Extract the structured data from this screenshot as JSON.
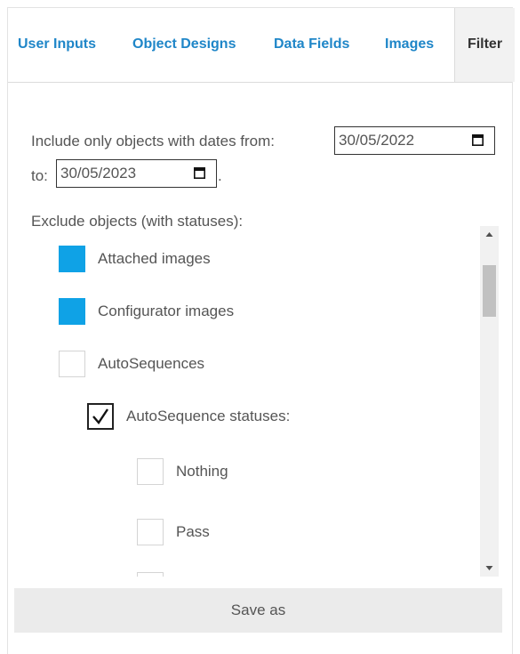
{
  "tabs": [
    {
      "label": "User Inputs"
    },
    {
      "label": "Object Designs"
    },
    {
      "label": "Data Fields"
    },
    {
      "label": "Images"
    },
    {
      "label": "Filter",
      "active": true
    }
  ],
  "date_filter": {
    "prefix": "Include only objects with dates from:",
    "from_value": "30/05/2022",
    "to_label": "to:",
    "to_value": "30/05/2023",
    "suffix": "."
  },
  "exclude_heading": "Exclude objects (with statuses):",
  "status_list": {
    "items": [
      {
        "label": "Attached images",
        "state": "filled"
      },
      {
        "label": "Configurator images",
        "state": "filled"
      },
      {
        "label": "AutoSequences",
        "state": "unchecked"
      },
      {
        "label": "AutoSequence statuses:",
        "state": "checked"
      },
      {
        "label": "Nothing",
        "state": "unchecked"
      },
      {
        "label": "Pass",
        "state": "unchecked"
      }
    ]
  },
  "save_label": "Save as",
  "colors": {
    "accent": "#1f86c8",
    "checkbox_fill": "#0fa2e6"
  }
}
